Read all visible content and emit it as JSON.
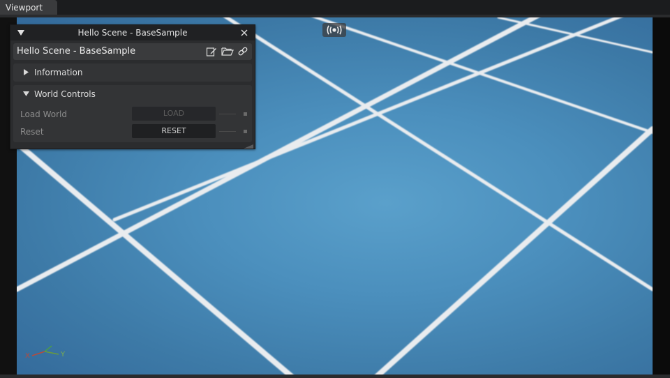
{
  "window": {
    "tab_label": "Viewport"
  },
  "viewport": {
    "axis_labels": {
      "x": "X",
      "y": "Y"
    },
    "camera_icon": "broadcast-camera-icon"
  },
  "panel": {
    "title": "Hello Scene - BaseSample",
    "header_label": "Hello Scene - BaseSample",
    "header_icons": [
      "edit-icon",
      "folder-open-icon",
      "link-icon"
    ],
    "sections": {
      "information": {
        "label": "Information",
        "expanded": false
      },
      "world_controls": {
        "label": "World Controls",
        "expanded": true,
        "rows": [
          {
            "label": "Load World",
            "button": "LOAD",
            "enabled": false
          },
          {
            "label": "Reset",
            "button": "RESET",
            "enabled": true
          }
        ]
      }
    }
  }
}
